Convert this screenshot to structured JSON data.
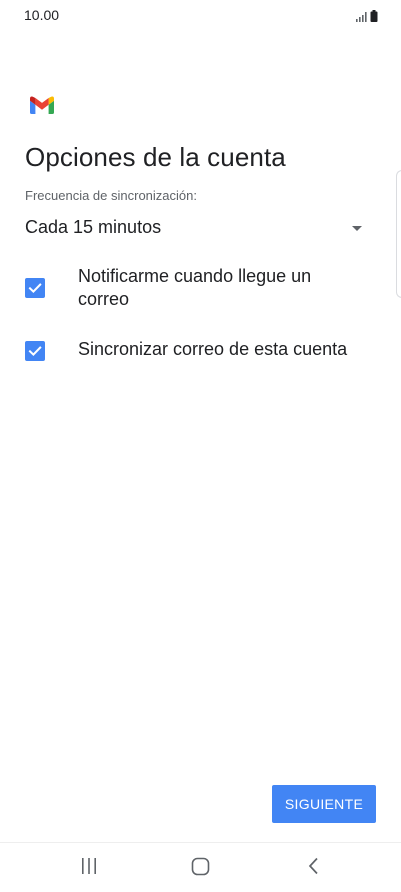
{
  "status_bar": {
    "time": "10.00",
    "icons": [
      "signal-icon",
      "battery-icon"
    ]
  },
  "app": {
    "logo_icon": "gmail-logo-icon"
  },
  "page": {
    "title": "Opciones de la cuenta",
    "sync_label": "Frecuencia de sincronización:",
    "sync_value": "Cada 15 minutos",
    "options": [
      {
        "label": "Notificarme cuando llegue un correo",
        "checked": true
      },
      {
        "label": "Sincronizar correo de esta cuenta",
        "checked": true
      }
    ],
    "next_label": "SIGUIENTE"
  },
  "navigation": {
    "buttons": [
      "recents-icon",
      "home-icon",
      "back-icon"
    ]
  },
  "colors": {
    "accent": "#4285f4",
    "text_primary": "#202124",
    "text_secondary": "#5f6368"
  }
}
